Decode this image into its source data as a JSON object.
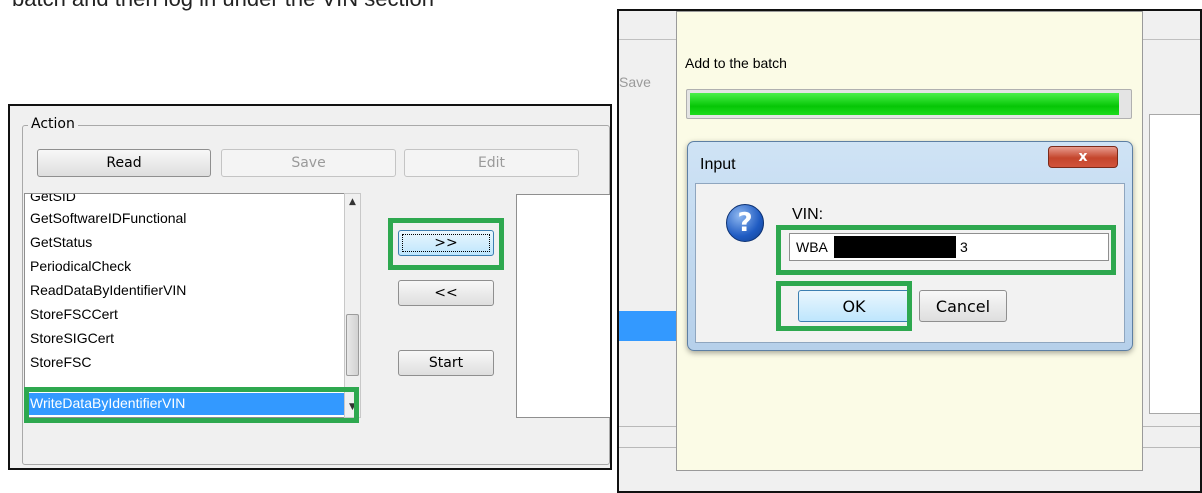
{
  "caption": {
    "text": "batch and then log in under the VIN section"
  },
  "left_panel": {
    "group_label": "Action",
    "buttons": {
      "read": "Read",
      "save": "Save",
      "edit": "Edit"
    },
    "list_items": [
      "GetSID",
      "GetSoftwareIDFunctional",
      "GetStatus",
      "PeriodicalCheck",
      "ReadDataByIdentifierVIN",
      "StoreFSCCert",
      "StoreSIGCert",
      "StoreFSC",
      "WriteDataByIdentifierVIN"
    ],
    "selected_item": "WriteDataByIdentifierVIN",
    "scrollbar": {
      "up_icon": "▲",
      "down_icon": "▼"
    },
    "move_right_label": ">>",
    "move_left_label": "<<",
    "start_label": "Start"
  },
  "right_panel": {
    "save_ghost": "Save",
    "batch_dialog": {
      "title": "Add to the batch",
      "progress": 0.98
    },
    "input_dialog": {
      "title": "Input",
      "close_label": "x",
      "help_icon": "?",
      "vin_label": "VIN:",
      "vin_prefix": "WBA",
      "vin_suffix": "3",
      "ok_label": "OK",
      "cancel_label": "Cancel"
    }
  },
  "colors": {
    "highlight": "#2ea84f",
    "selection": "#3399ff",
    "progress": "#06c606"
  }
}
